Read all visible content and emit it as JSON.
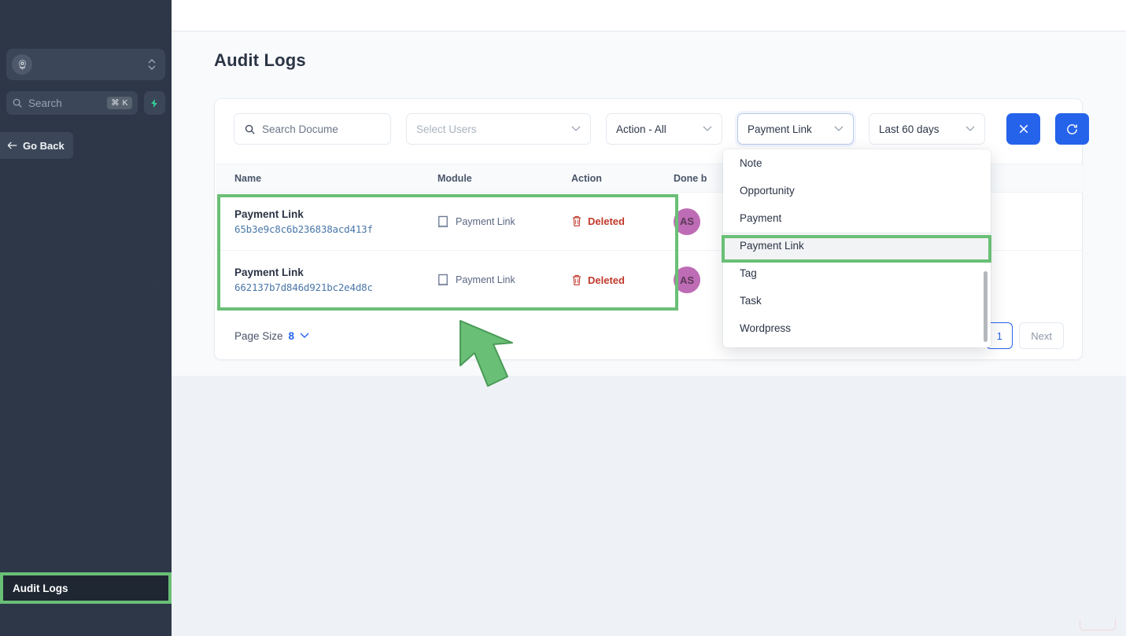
{
  "sidebar": {
    "org_switcher": {
      "icon": "org-avatar-icon",
      "stepper_icon": "chevron-updown-icon"
    },
    "search": {
      "placeholder": "Search",
      "shortcut": "⌘ K",
      "icon": "search-icon"
    },
    "spark_button": {
      "icon": "lightning-bolt-icon"
    },
    "go_back": {
      "label": "Go Back",
      "icon": "arrow-left-icon"
    },
    "active_item": {
      "label": "Audit Logs"
    }
  },
  "page": {
    "title": "Audit Logs"
  },
  "filters": {
    "search_documents": {
      "value": "",
      "placeholder": "Search Docume",
      "icon": "search-icon"
    },
    "select_users": {
      "value": "",
      "placeholder": "Select Users"
    },
    "action": {
      "value": "Action - All"
    },
    "module": {
      "value": "Payment Link"
    },
    "date_range": {
      "value": "Last 60 days"
    },
    "clear_button": {
      "icon": "close-icon",
      "color": "#2563eb"
    },
    "refresh_button": {
      "icon": "refresh-icon",
      "color": "#2563eb"
    }
  },
  "module_dropdown": {
    "options": [
      {
        "label": "Note",
        "selected": false
      },
      {
        "label": "Opportunity",
        "selected": false
      },
      {
        "label": "Payment",
        "selected": false
      },
      {
        "label": "Payment Link",
        "selected": true
      },
      {
        "label": "Tag",
        "selected": false
      },
      {
        "label": "Task",
        "selected": false
      },
      {
        "label": "Wordpress",
        "selected": false
      }
    ]
  },
  "table": {
    "columns": [
      "Name",
      "Module",
      "Action",
      "Done b"
    ],
    "rows": [
      {
        "name": "Payment Link",
        "id": "65b3e9c8c6b236838acd413f",
        "module": "Payment Link",
        "module_icon": "receipt-icon",
        "action": "Deleted",
        "action_icon": "trash-icon",
        "done_by_initials": "AS"
      },
      {
        "name": "Payment Link",
        "id": "662137b7d846d921bc2e4d8c",
        "module": "Payment Link",
        "module_icon": "receipt-icon",
        "action": "Deleted",
        "action_icon": "trash-icon",
        "done_by_initials": "AS"
      }
    ]
  },
  "footer": {
    "page_size_label": "Page Size",
    "page_size_value": "8",
    "page_current": "1",
    "next_label": "Next"
  },
  "colors": {
    "accent_blue": "#2563eb",
    "highlight_green": "#6abf76",
    "danger_red": "#c0392b",
    "avatar_purple": "#bd6cb5",
    "sidebar_bg": "#2d3748"
  }
}
